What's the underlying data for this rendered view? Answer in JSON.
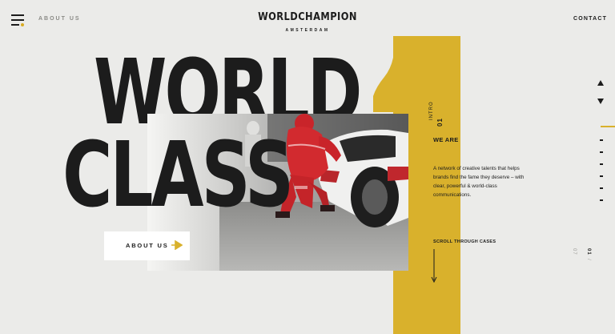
{
  "header": {
    "about_link": "ABOUT US",
    "brand": "WORLDCHAMPION",
    "brand_sub": "AMSTERDAM",
    "contact_link": "CONTACT"
  },
  "hero": {
    "big_number": "1",
    "headline_line1": "WORLD",
    "headline_line2": "CLASS",
    "about_button_label": "ABOUT US"
  },
  "intro": {
    "label": "INTRO",
    "number": "01",
    "title": "WE ARE",
    "description": "A network of creative talents that helps brands find the fame they deserve – with clear, powerful & world-class communications.",
    "scroll_label": "SCROLL THROUGH CASES"
  },
  "rail": {
    "current": "01",
    "separator": "/",
    "total": "07"
  },
  "colors": {
    "background": "#ebebe9",
    "accent": "#d9b12c",
    "text": "#1c1c1c"
  },
  "icons": {
    "menu": "hamburger-icon",
    "arrow_right": "arrow-right-icon",
    "arrow_down": "arrow-down-icon",
    "up": "triangle-up-icon",
    "down": "triangle-down-icon"
  }
}
